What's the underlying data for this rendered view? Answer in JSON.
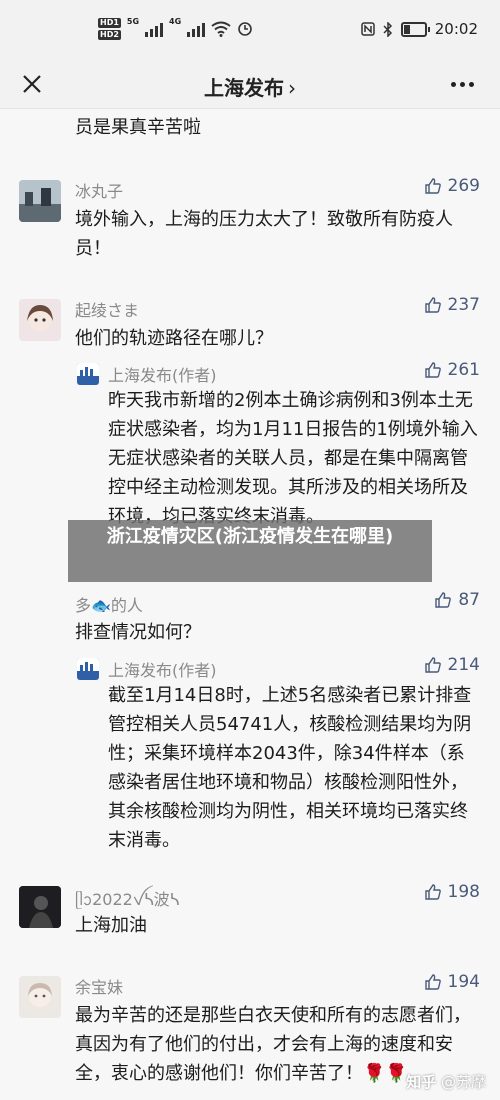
{
  "status": {
    "hd1": "HD1",
    "hd2": "HD2",
    "net1": "5G",
    "net2": "4G",
    "time": "20:02"
  },
  "nav": {
    "title": "上海发布",
    "chevron": "›",
    "close_icon": "close-icon",
    "more_icon": "more-icon"
  },
  "feed": {
    "top_fragment": "员是果真辛苦啦",
    "comments": [
      {
        "author": "冰丸子",
        "likes": "269",
        "text": "境外输入，上海的压力太大了！致敬所有防疫人员！"
      },
      {
        "author": "起绫さま",
        "likes": "237",
        "text": "他们的轨迹路径在哪儿？",
        "reply": {
          "author": "上海发布(作者)",
          "likes": "261",
          "text": "昨天我市新增的2例本土确诊病例和3例本土无症状感染者，均为1月11日报告的1例境外输入无症状感染者的关联人员，都是在集中隔离管控中经主动检测发现。其所涉及的相关场所及环境，均已落实终末消毒。"
        }
      },
      {
        "author": "多🐟的人",
        "likes": "87",
        "text": "排查情况如何？",
        "reply": {
          "author": "上海发布(作者)",
          "likes": "214",
          "text": "截至1月14日8时，上述5名感染者已累计排查管控相关人员54741人，核酸检测结果均为阴性；采集环境样本2043件，除34件样本（系感染者居住地环境和物品）核酸检测阳性外，其余核酸检测均为阴性，相关环境均已落实终末消毒。"
        }
      },
      {
        "author": "ᥫᩣ2022ꪜᓴ波ᓴ",
        "likes": "198",
        "text": "上海加油"
      },
      {
        "author": "余宝妹",
        "likes": "194",
        "text": "最为辛苦的还是那些白衣天使和所有的志愿者们，真因为有了他们的付出，才会有上海的速度和安全，衷心的感谢他们！你们辛苦了！🌹🌹"
      }
    ]
  },
  "overlay": {
    "banner": "浙江疫情灾区(浙江疫情发生在哪里)",
    "watermark_brand": "知乎",
    "watermark_user": "@苏摩"
  },
  "colors": {
    "like": "#4a5a7a",
    "author": "#8a8a8a",
    "background": "#f7f7f7"
  }
}
